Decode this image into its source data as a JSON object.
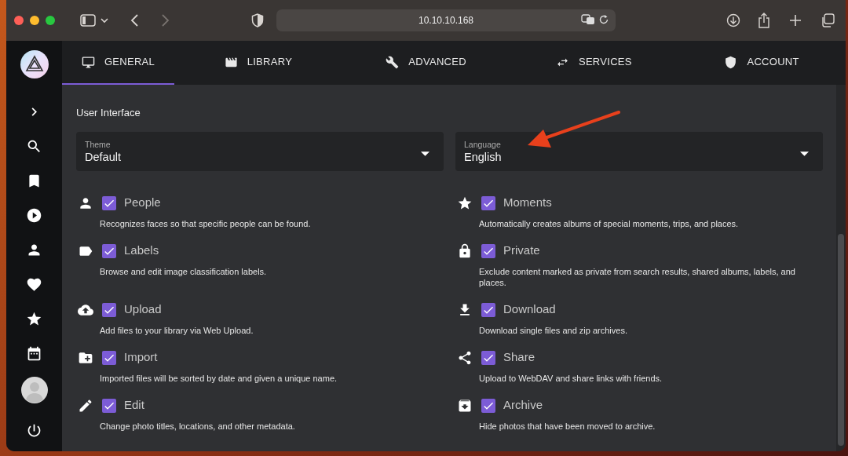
{
  "browser": {
    "url": "10.10.10.168",
    "back_disabled": false,
    "forward_disabled": true
  },
  "tabs": [
    {
      "label": "GENERAL",
      "selected": true
    },
    {
      "label": "LIBRARY",
      "selected": false
    },
    {
      "label": "ADVANCED",
      "selected": false
    },
    {
      "label": "SERVICES",
      "selected": false
    },
    {
      "label": "ACCOUNT",
      "selected": false
    }
  ],
  "section_title": "User Interface",
  "selects": [
    {
      "label": "Theme",
      "value": "Default"
    },
    {
      "label": "Language",
      "value": "English"
    }
  ],
  "features": [
    {
      "label": "People",
      "description": "Recognizes faces so that specific people can be found.",
      "checked": true
    },
    {
      "label": "Moments",
      "description": "Automatically creates albums of special moments, trips, and places.",
      "checked": true
    },
    {
      "label": "Labels",
      "description": "Browse and edit image classification labels.",
      "checked": true
    },
    {
      "label": "Private",
      "description": "Exclude content marked as private from search results, shared albums, labels, and places.",
      "checked": true
    },
    {
      "label": "Upload",
      "description": "Add files to your library via Web Upload.",
      "checked": true
    },
    {
      "label": "Download",
      "description": "Download single files and zip archives.",
      "checked": true
    },
    {
      "label": "Import",
      "description": "Imported files will be sorted by date and given a unique name.",
      "checked": true
    },
    {
      "label": "Share",
      "description": "Upload to WebDAV and share links with friends.",
      "checked": true
    },
    {
      "label": "Edit",
      "description": "Change photo titles, locations, and other metadata.",
      "checked": true
    },
    {
      "label": "Archive",
      "description": "Hide photos that have been moved to archive.",
      "checked": true
    }
  ]
}
